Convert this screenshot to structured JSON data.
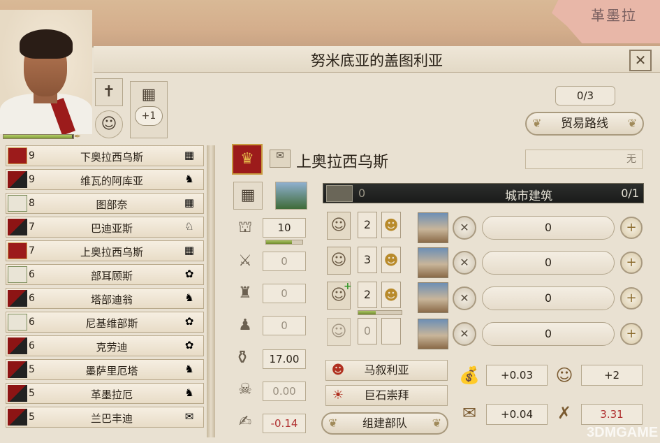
{
  "region_title": "努米底亚的盖图利亚",
  "close": "✕",
  "counts": {
    "trade_slots": "0/3",
    "add_label": "+1"
  },
  "trade_button": "贸易路线",
  "region": {
    "name": "上奥拉西乌斯",
    "status": "无"
  },
  "city_buildings": {
    "zero": "0",
    "label": "城市建筑",
    "count": "0/1"
  },
  "provinces": [
    {
      "num": "9",
      "name": "下奥拉西乌斯",
      "faction": "rome",
      "resource": "stone"
    },
    {
      "num": "9",
      "name": "维瓦的阿库亚",
      "faction": "red",
      "resource": "horse"
    },
    {
      "num": "8",
      "name": "图部奈",
      "faction": "green",
      "resource": "stone"
    },
    {
      "num": "7",
      "name": "巴迪亚斯",
      "faction": "red",
      "resource": "goat"
    },
    {
      "num": "7",
      "name": "上奥拉西乌斯",
      "faction": "rome",
      "resource": "stone"
    },
    {
      "num": "6",
      "name": "部耳顾斯",
      "faction": "green",
      "resource": "flower"
    },
    {
      "num": "6",
      "name": "塔部迪翁",
      "faction": "red",
      "resource": "horse"
    },
    {
      "num": "6",
      "name": "尼基维部斯",
      "faction": "green",
      "resource": "flower"
    },
    {
      "num": "6",
      "name": "克劳迪",
      "faction": "red",
      "resource": "flower"
    },
    {
      "num": "5",
      "name": "墨萨里厄塔",
      "faction": "red",
      "resource": "horse"
    },
    {
      "num": "5",
      "name": "革墨拉厄",
      "faction": "red",
      "resource": "horse"
    },
    {
      "num": "5",
      "name": "兰巴丰迪",
      "faction": "red",
      "resource": "scroll"
    }
  ],
  "stats": {
    "civic": "10",
    "civic_fill": 0.72,
    "military": "0",
    "fort": "0",
    "troops": "0",
    "wealth": "17.00",
    "death": "0.00",
    "tax": "-0.14"
  },
  "pops": [
    {
      "count": "2",
      "fill": 0
    },
    {
      "count": "3",
      "fill": 0
    },
    {
      "count": "2",
      "fill": 0.4
    },
    {
      "count": "0",
      "fill": 0
    }
  ],
  "building_slots": [
    "0",
    "0",
    "0",
    "0"
  ],
  "culture": "马叙利亚",
  "religion": "巨石崇拜",
  "army_button": "组建部队",
  "economy": {
    "income": "+0.03",
    "pop_growth": "+2",
    "trade": "+0.04",
    "food": "3.31"
  },
  "map_label": "革墨拉",
  "watermark": "3DMGAME",
  "colors": {
    "accent_red": "#9c1b1b",
    "gold": "#c89a3e",
    "negative": "#b03030"
  }
}
